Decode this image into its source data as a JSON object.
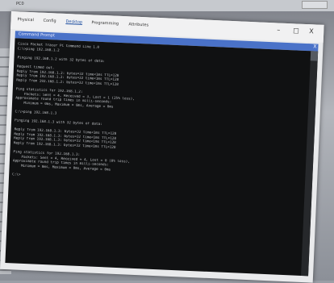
{
  "window": {
    "title": "PC0",
    "tabs": [
      "Physical",
      "Config",
      "Desktop",
      "Programming",
      "Attributes"
    ],
    "active_tab": "Desktop",
    "min_glyph": "–",
    "max_glyph": "□",
    "close_glyph": "X"
  },
  "command_prompt": {
    "title": "Command Prompt",
    "close_glyph": "X",
    "lines": [
      "Cisco Packet Tracer PC Command Line 1.0",
      "C:\\>ping 192.168.1.2",
      "",
      "Pinging 192.168.1.2 with 32 bytes of data:",
      "",
      "Request timed out.",
      "Reply from 192.168.1.2: bytes=32 time<1ms TTL=128",
      "Reply from 192.168.1.2: bytes=32 time<1ms TTL=128",
      "Reply from 192.168.1.2: bytes=32 time<1ms TTL=128",
      "",
      "Ping statistics for 192.168.1.2:",
      "    Packets: Sent = 4, Received = 3, Lost = 1 (25% loss),",
      "Approximate round trip times in milli-seconds:",
      "    Minimum = 0ms, Maximum = 0ms, Average = 0ms",
      "",
      "C:\\>ping 192.168.1.3",
      "",
      "Pinging 192.168.1.3 with 32 bytes of data:",
      "",
      "Reply from 192.168.1.3: bytes=32 time<1ms TTL=128",
      "Reply from 192.168.1.3: bytes=32 time<1ms TTL=128",
      "Reply from 192.168.1.3: bytes=32 time<1ms TTL=128",
      "Reply from 192.168.1.3: bytes=32 time<1ms TTL=128",
      "",
      "Ping statistics for 192.168.1.3:",
      "    Packets: Sent = 4, Received = 4, Lost = 0 (0% loss),",
      "Approximate round trip times in milli-seconds:",
      "    Minimum = 0ms, Maximum = 0ms, Average = 0ms",
      "",
      "C:\\>"
    ]
  },
  "colors": {
    "terminal_bg": "#101112",
    "terminal_text": "#bfc2c6",
    "title_accent": "#4a72c8"
  }
}
